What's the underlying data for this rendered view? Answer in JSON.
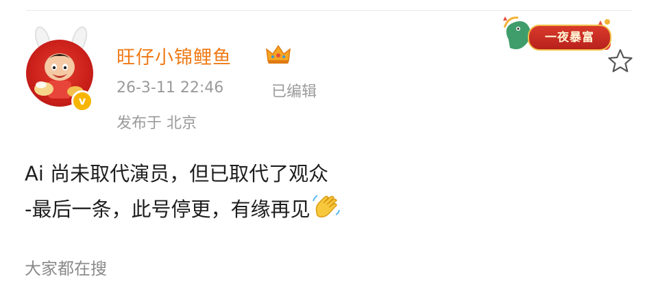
{
  "post": {
    "author": {
      "name": "旺仔小锦鲤鱼",
      "verified": true
    },
    "meta": {
      "timestamp": "26-3-11 22:46",
      "edited": "已编辑",
      "location": "发布于 北京"
    },
    "badge": {
      "label": "一夜暴富"
    },
    "content": {
      "line1": "Ai 尚未取代演员，但已取代了观众",
      "line2": "-最后一条，此号停更，有缘再见",
      "emoji": "waving-hand"
    }
  },
  "trending": {
    "label": "大家都在搜"
  },
  "colors": {
    "username": "#ef7a16",
    "meta": "#9a9a9a",
    "badge_bg": "#c62a20",
    "verified": "#f7b500"
  }
}
